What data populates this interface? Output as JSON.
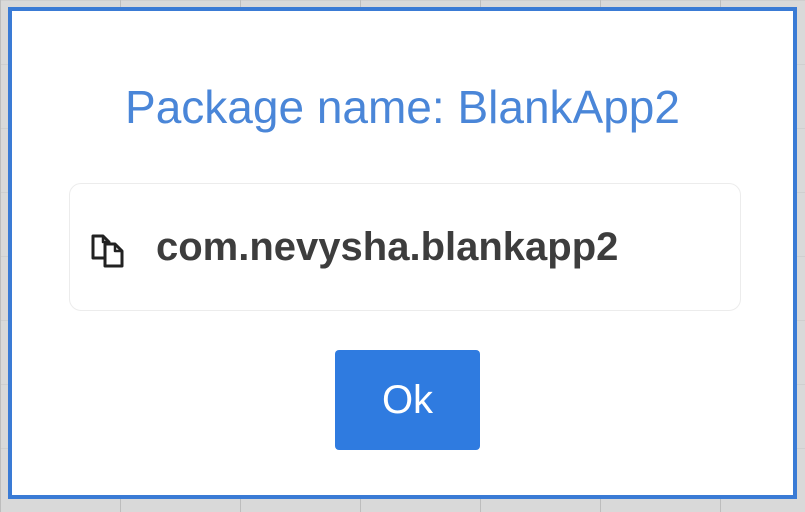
{
  "dialog": {
    "title": "Package name: BlankApp2",
    "package_name": "com.nevysha.blankapp2",
    "copy_icon": "copy-icon",
    "ok_label": "Ok"
  },
  "colors": {
    "border": "#3a7bd5",
    "title": "#4a86d8",
    "button": "#2f7be0",
    "package_text": "#3d3d3d"
  }
}
